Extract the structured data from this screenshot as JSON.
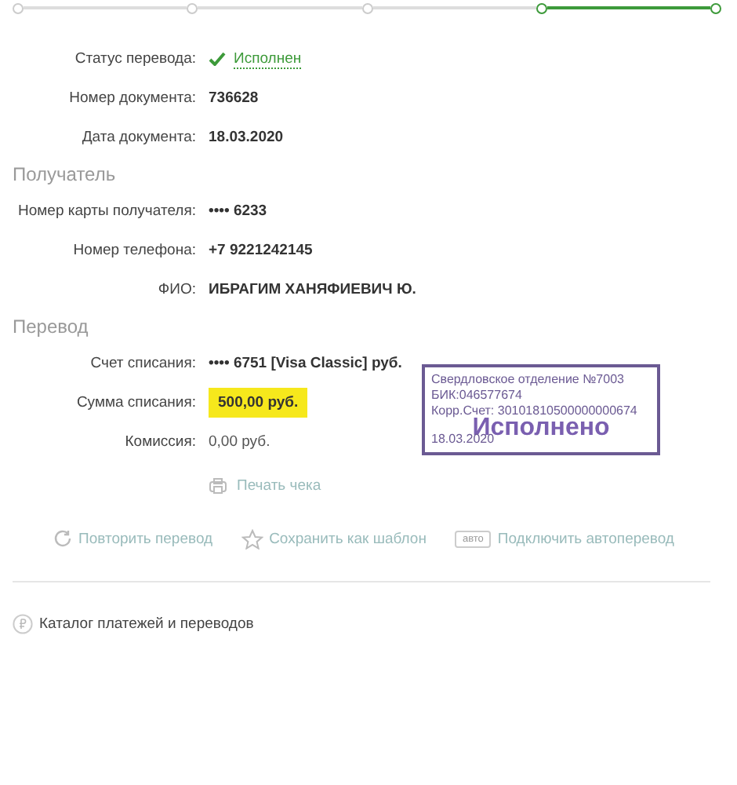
{
  "steps": [
    {
      "active": false
    },
    {
      "active": false
    },
    {
      "active": false
    },
    {
      "active": true
    },
    {
      "active": true
    }
  ],
  "details": [
    {
      "label": "Статус перевода:",
      "value": "Исполнен",
      "kind": "status"
    },
    {
      "label": "Номер документа:",
      "value": "736628",
      "kind": "bold"
    },
    {
      "label": "Дата документа:",
      "value": "18.03.2020",
      "kind": "bold"
    }
  ],
  "recipient": {
    "title": "Получатель",
    "rows": [
      {
        "label": "Номер карты получателя:",
        "value": "•••• 6233",
        "kind": "bold"
      },
      {
        "label": "Номер телефона:",
        "value": "+7 9221242145",
        "kind": "bold"
      },
      {
        "label": "ФИО:",
        "value": "ИБРАГИМ ХАНЯФИЕВИЧ Ю.",
        "kind": "bold"
      }
    ]
  },
  "transfer": {
    "title": "Перевод",
    "rows": [
      {
        "label": "Счет списания:",
        "value": "•••• 6751  [Visa Classic]  руб.",
        "kind": "bold"
      },
      {
        "label": "Сумма списания:",
        "value": "500,00  руб.",
        "kind": "highlight"
      },
      {
        "label": "Комиссия:",
        "value": "0,00 руб.",
        "kind": "plain"
      }
    ]
  },
  "stamp": {
    "lines": [
      "Свердловское отделение №7003",
      "БИК:046577674",
      "Корр.Счет: 30101810500000000674"
    ],
    "status": "Исполнено",
    "date": "18.03.2020"
  },
  "print": "Печать чека",
  "actions": [
    {
      "kind": "repeat",
      "label": "Повторить перевод"
    },
    {
      "kind": "star",
      "label": "Сохранить как шаблон"
    },
    {
      "kind": "auto",
      "badge": "авто",
      "label": "Подключить автоперевод"
    }
  ],
  "catalog": "Каталог платежей и переводов"
}
